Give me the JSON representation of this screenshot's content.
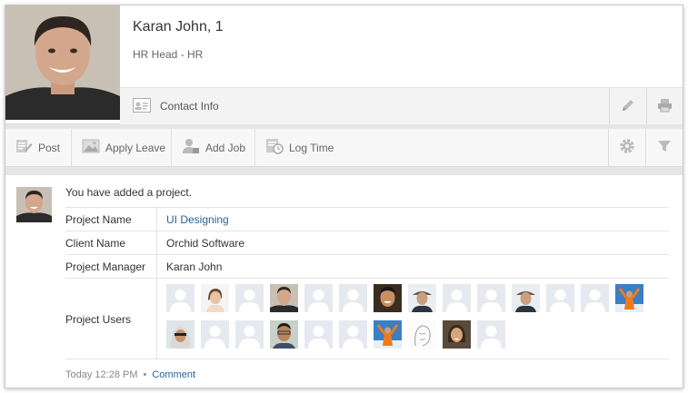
{
  "profile": {
    "name": "Karan John, 1",
    "role": "HR Head - HR",
    "contact_label": "Contact Info"
  },
  "icons": {
    "edit": "pencil-icon",
    "print": "printer-icon",
    "contact": "contact-card-icon",
    "settings": "gear-icon",
    "filter": "funnel-icon"
  },
  "actions": [
    {
      "label": "Post",
      "icon": "post-icon"
    },
    {
      "label": "Apply Leave",
      "icon": "leave-icon"
    },
    {
      "label": "Add Job",
      "icon": "add-job-icon"
    },
    {
      "label": "Log Time",
      "icon": "log-time-icon"
    }
  ],
  "feed": {
    "message": "You have added a project.",
    "details": [
      {
        "key": "Project Name",
        "value": "UI Designing",
        "link": true
      },
      {
        "key": "Client Name",
        "value": "Orchid Software",
        "link": false
      },
      {
        "key": "Project Manager",
        "value": "Karan John",
        "link": false
      }
    ],
    "users_label": "Project Users",
    "users": [
      "placeholder",
      "woman",
      "placeholder",
      "man",
      "placeholder",
      "placeholder",
      "smiling-man",
      "hat-man",
      "placeholder",
      "placeholder",
      "hat-man",
      "placeholder",
      "placeholder",
      "climber",
      "hijab-woman",
      "placeholder",
      "placeholder",
      "glasses-man",
      "placeholder",
      "placeholder",
      "climber",
      "sketch",
      "woman-2",
      "placeholder"
    ],
    "time": "Today 12:28 PM",
    "separator": "•",
    "comment_label": "Comment"
  },
  "colors": {
    "link": "#2a6496",
    "bar_bg": "#f3f3f3",
    "gap_bg": "#e6e6e6"
  }
}
